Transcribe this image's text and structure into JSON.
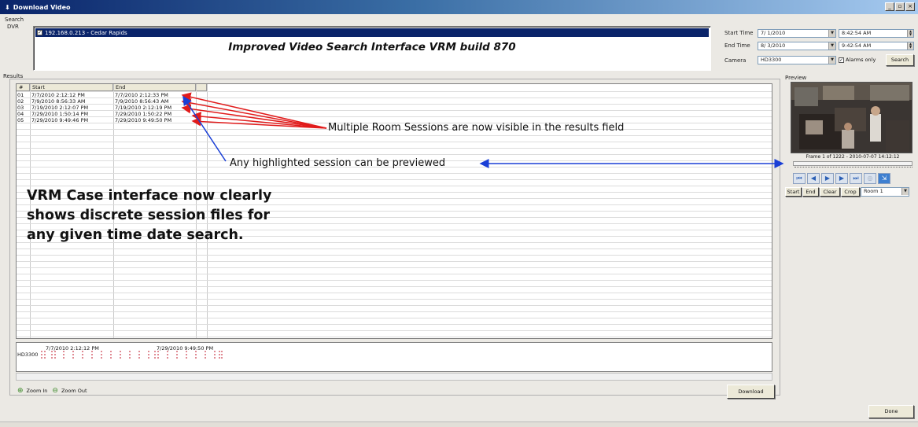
{
  "window": {
    "title": "Download Video",
    "icon": "download-arrow-icon"
  },
  "search": {
    "group_label": "Search",
    "dvr_label": "DVR",
    "dvr_entry": "192.168.0.213 - Cedar Rapids",
    "dvr_checked": true,
    "headline": "Improved Video Search Interface VRM build 870",
    "start_time_label": "Start Time",
    "start_date": "7/ 1/2010",
    "start_time": "8:42:54 AM",
    "end_time_label": "End Time",
    "end_date": "8/ 3/2010",
    "end_time": "9:42:54 AM",
    "camera_label": "Camera",
    "camera_value": "HD3300",
    "alarms_only_label": "Alarms only",
    "alarms_only_checked": true,
    "search_button": "Search"
  },
  "results": {
    "group_label": "Results",
    "columns": [
      "#",
      "Start",
      "End"
    ],
    "rows": [
      {
        "num": "01",
        "start": "7/7/2010 2:12:12 PM",
        "end": "7/7/2010 2:12:33 PM"
      },
      {
        "num": "02",
        "start": "7/9/2010 8:56:33 AM",
        "end": "7/9/2010 8:56:43 AM"
      },
      {
        "num": "03",
        "start": "7/19/2010 2:12:07 PM",
        "end": "7/19/2010 2:12:19 PM"
      },
      {
        "num": "04",
        "start": "7/29/2010 1:50:14 PM",
        "end": "7/29/2010 1:50:22 PM"
      },
      {
        "num": "05",
        "start": "7/29/2010 9:49:46 PM",
        "end": "7/29/2010 9:49:50 PM"
      }
    ]
  },
  "annotations": {
    "multiple_sessions": "Multiple Room Sessions are now visible in the results field",
    "preview_note": "Any highlighted session can be previewed",
    "case_lines": [
      "VRM Case interface now clearly",
      "shows discrete session files for",
      "any given time date search."
    ],
    "arrow_color": "#e11b1b",
    "blue_arrow_color": "#1a3fd6"
  },
  "timeline": {
    "start_label": "7/7/2010 2:12:12 PM",
    "end_label": "7/29/2010 9:49:50 PM",
    "track_label": "HD3300"
  },
  "zoom": {
    "zoom_in": "Zoom In",
    "zoom_out": "Zoom Out"
  },
  "download_button": "Download",
  "preview": {
    "group_label": "Preview",
    "frame_info": "Frame 1 of 1222 - 2010-07-07 14:12:12",
    "controls": [
      "skip-to-start-icon",
      "step-back-icon",
      "play-icon",
      "step-forward-icon",
      "skip-to-end-icon",
      "snapshot-icon",
      "fit-icon"
    ],
    "start_button": "Start",
    "end_button": "End",
    "clear_button": "Clear",
    "crop_button": "Crop",
    "room_value": "Room 1"
  },
  "done_button": "Done",
  "colors": {
    "titlebar": "#0a246a",
    "selection": "#0a246a",
    "accent_blue": "#2b5fb5"
  }
}
